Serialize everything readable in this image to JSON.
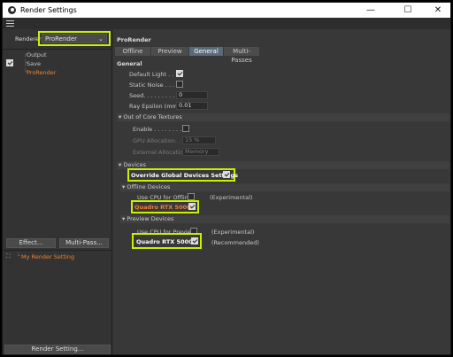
{
  "window": {
    "title": "Render Settings",
    "minimize": "—",
    "maximize": "☐",
    "close": "✕"
  },
  "left": {
    "renderer_label": "Renderer",
    "renderer_value": "ProRender",
    "tree": [
      "Output",
      "Save",
      "ProRender"
    ],
    "effect_button": "Effect...",
    "multipass_button": "Multi-Pass...",
    "setting_name": "My Render Setting",
    "render_setting_button": "Render Setting..."
  },
  "right": {
    "header": "ProRender",
    "tabs": [
      "Offline",
      "Preview",
      "General",
      "Multi-Passes"
    ],
    "active_tab": "General",
    "general_title": "General",
    "default_light": "Default Light . .",
    "static_noise": "Static Noise . . .",
    "seed_label": "Seed. . . . . . . . .",
    "seed_value": "0",
    "ray_label": "Ray Epsilon (mm)",
    "ray_value": "0.01",
    "out_of_core": "Out of Core Textures",
    "enable_label": "Enable . . . . . . . .",
    "gpu_alloc_label": "GPU Allocation. . .",
    "gpu_alloc_value": "15 %",
    "ext_alloc_label": "External Allocation",
    "ext_alloc_value": "Memory",
    "devices": "Devices",
    "override": "Override Global Devices Settings",
    "offline_devices": "Offline Devices",
    "use_cpu_offline": "Use CPU for Offline",
    "experimental1": "(Experimental)",
    "gpu_offline": "Quadro RTX 5000",
    "preview_devices": "Preview Devices",
    "use_cpu_preview": "Use CPU for Preview",
    "experimental2": "(Experimental)",
    "gpu_preview": "Quadro RTX 5000",
    "recommended": "(Recommended)"
  },
  "colors": {
    "highlight": "#c8f000",
    "accent_orange": "#f08030",
    "panel": "#383838"
  }
}
